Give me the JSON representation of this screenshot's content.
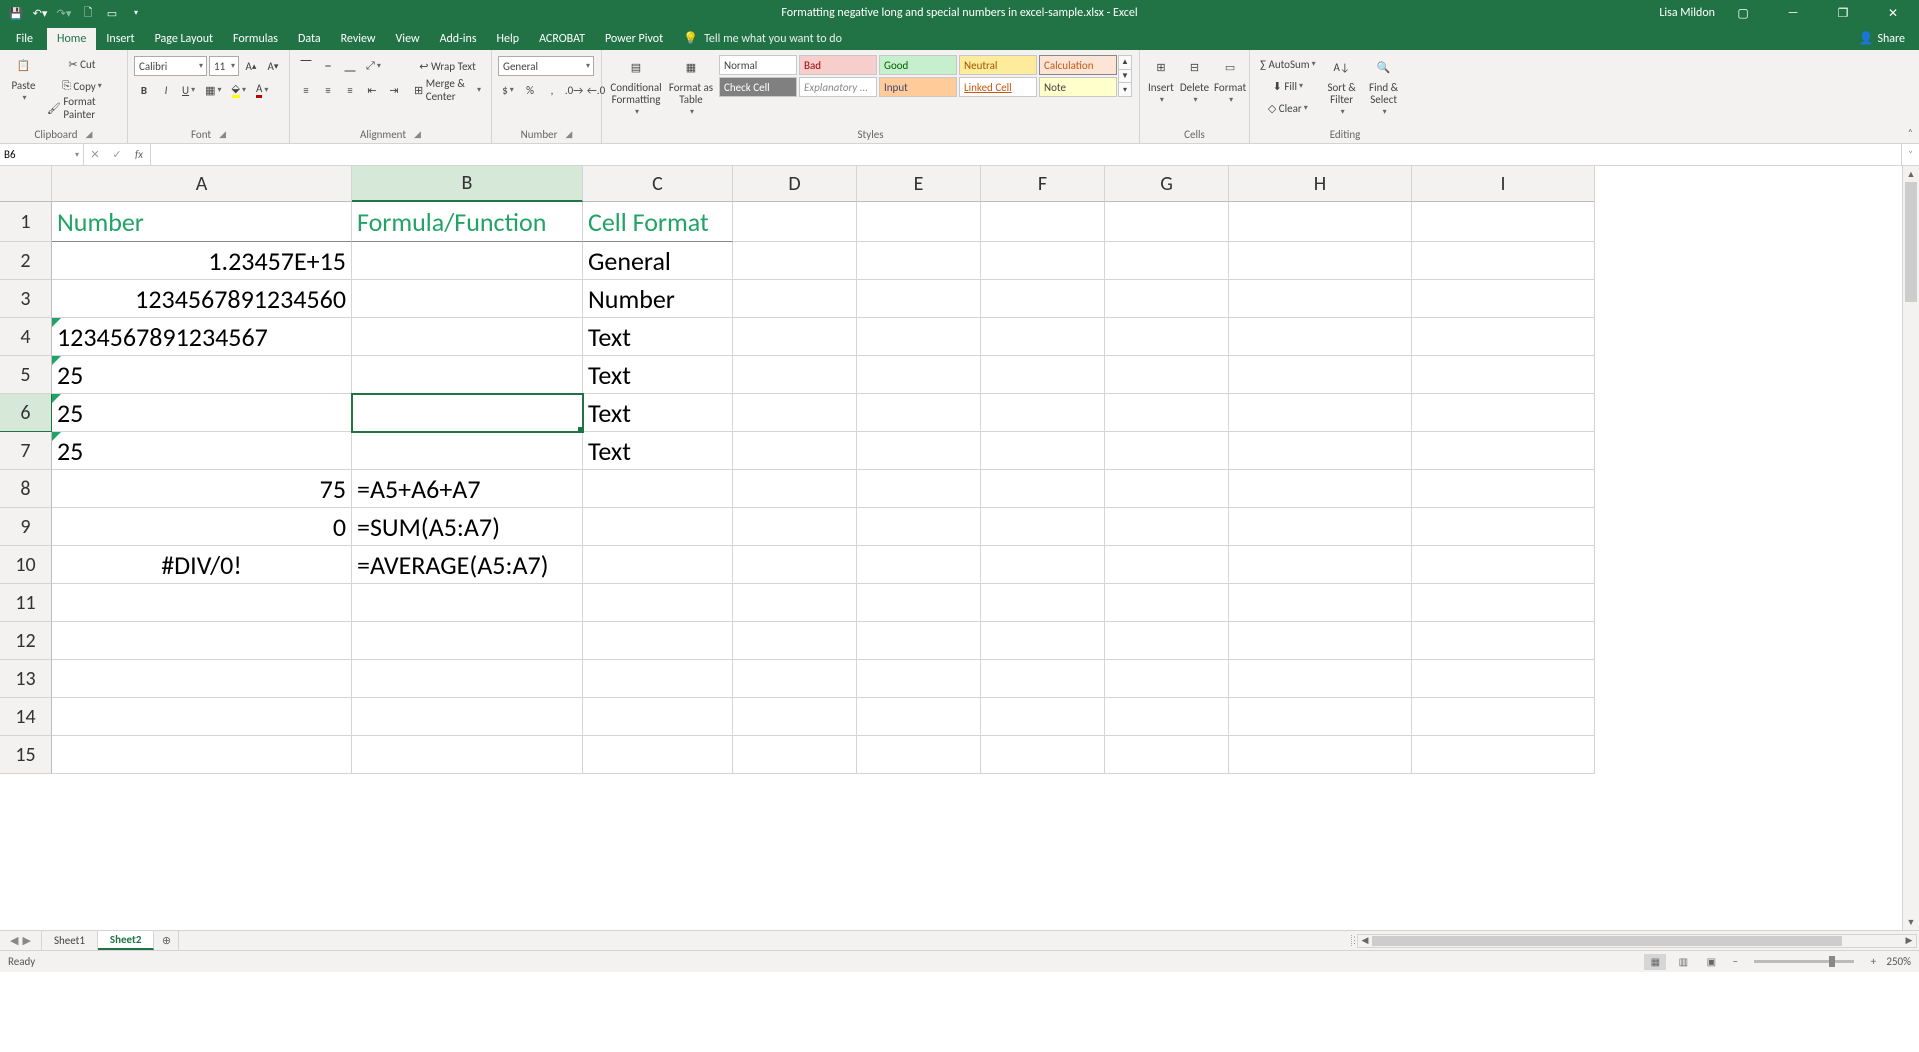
{
  "titlebar": {
    "doc_title": "Formatting negative long and special numbers in excel-sample.xlsx  -  Excel",
    "user": "Lisa Mildon"
  },
  "tabs": {
    "file": "File",
    "home": "Home",
    "insert": "Insert",
    "page_layout": "Page Layout",
    "formulas": "Formulas",
    "data": "Data",
    "review": "Review",
    "view": "View",
    "addins": "Add-ins",
    "help": "Help",
    "acrobat": "ACROBAT",
    "powerpivot": "Power Pivot",
    "tellme": "Tell me what you want to do",
    "share": "Share"
  },
  "ribbon": {
    "clipboard": {
      "label": "Clipboard",
      "paste": "Paste",
      "cut": "Cut",
      "copy": "Copy",
      "format_painter": "Format Painter"
    },
    "font": {
      "label": "Font",
      "name": "Calibri",
      "size": "11"
    },
    "alignment": {
      "label": "Alignment",
      "wrap": "Wrap Text",
      "merge": "Merge & Center"
    },
    "number": {
      "label": "Number",
      "format": "General"
    },
    "styles": {
      "label": "Styles",
      "conditional": "Conditional Formatting",
      "format_table": "Format as Table",
      "gallery": {
        "normal": "Normal",
        "bad": "Bad",
        "good": "Good",
        "neutral": "Neutral",
        "calculation": "Calculation",
        "check_cell": "Check Cell",
        "explanatory": "Explanatory ...",
        "input": "Input",
        "linked_cell": "Linked Cell",
        "note": "Note"
      }
    },
    "cells": {
      "label": "Cells",
      "insert": "Insert",
      "delete": "Delete",
      "format": "Format"
    },
    "editing": {
      "label": "Editing",
      "autosum": "AutoSum",
      "fill": "Fill",
      "clear": "Clear",
      "sort": "Sort & Filter",
      "find": "Find & Select"
    }
  },
  "namebox": {
    "ref": "B6"
  },
  "columns": [
    "A",
    "B",
    "C",
    "D",
    "E",
    "F",
    "G",
    "H",
    "I"
  ],
  "rows": [
    "1",
    "2",
    "3",
    "4",
    "5",
    "6",
    "7",
    "8",
    "9",
    "10",
    "11",
    "12",
    "13",
    "14",
    "15"
  ],
  "cells": {
    "A1": "Number",
    "B1": "Formula/Function",
    "C1": "Cell Format",
    "A2": "1.23457E+15",
    "C2": "General",
    "A3": "1234567891234560",
    "C3": "Number",
    "A4": "1234567891234567",
    "C4": "Text",
    "A5": "25",
    "C5": "Text",
    "A6": "25",
    "C6": "Text",
    "A7": "25",
    "C7": "Text",
    "A8": "75",
    "B8": "=A5+A6+A7",
    "A9": "0",
    "B9": "=SUM(A5:A7)",
    "A10": "#DIV/0!",
    "B10": "=AVERAGE(A5:A7)"
  },
  "sheet_tabs": {
    "s1": "Sheet1",
    "s2": "Sheet2"
  },
  "statusbar": {
    "ready": "Ready",
    "zoom": "250%"
  }
}
